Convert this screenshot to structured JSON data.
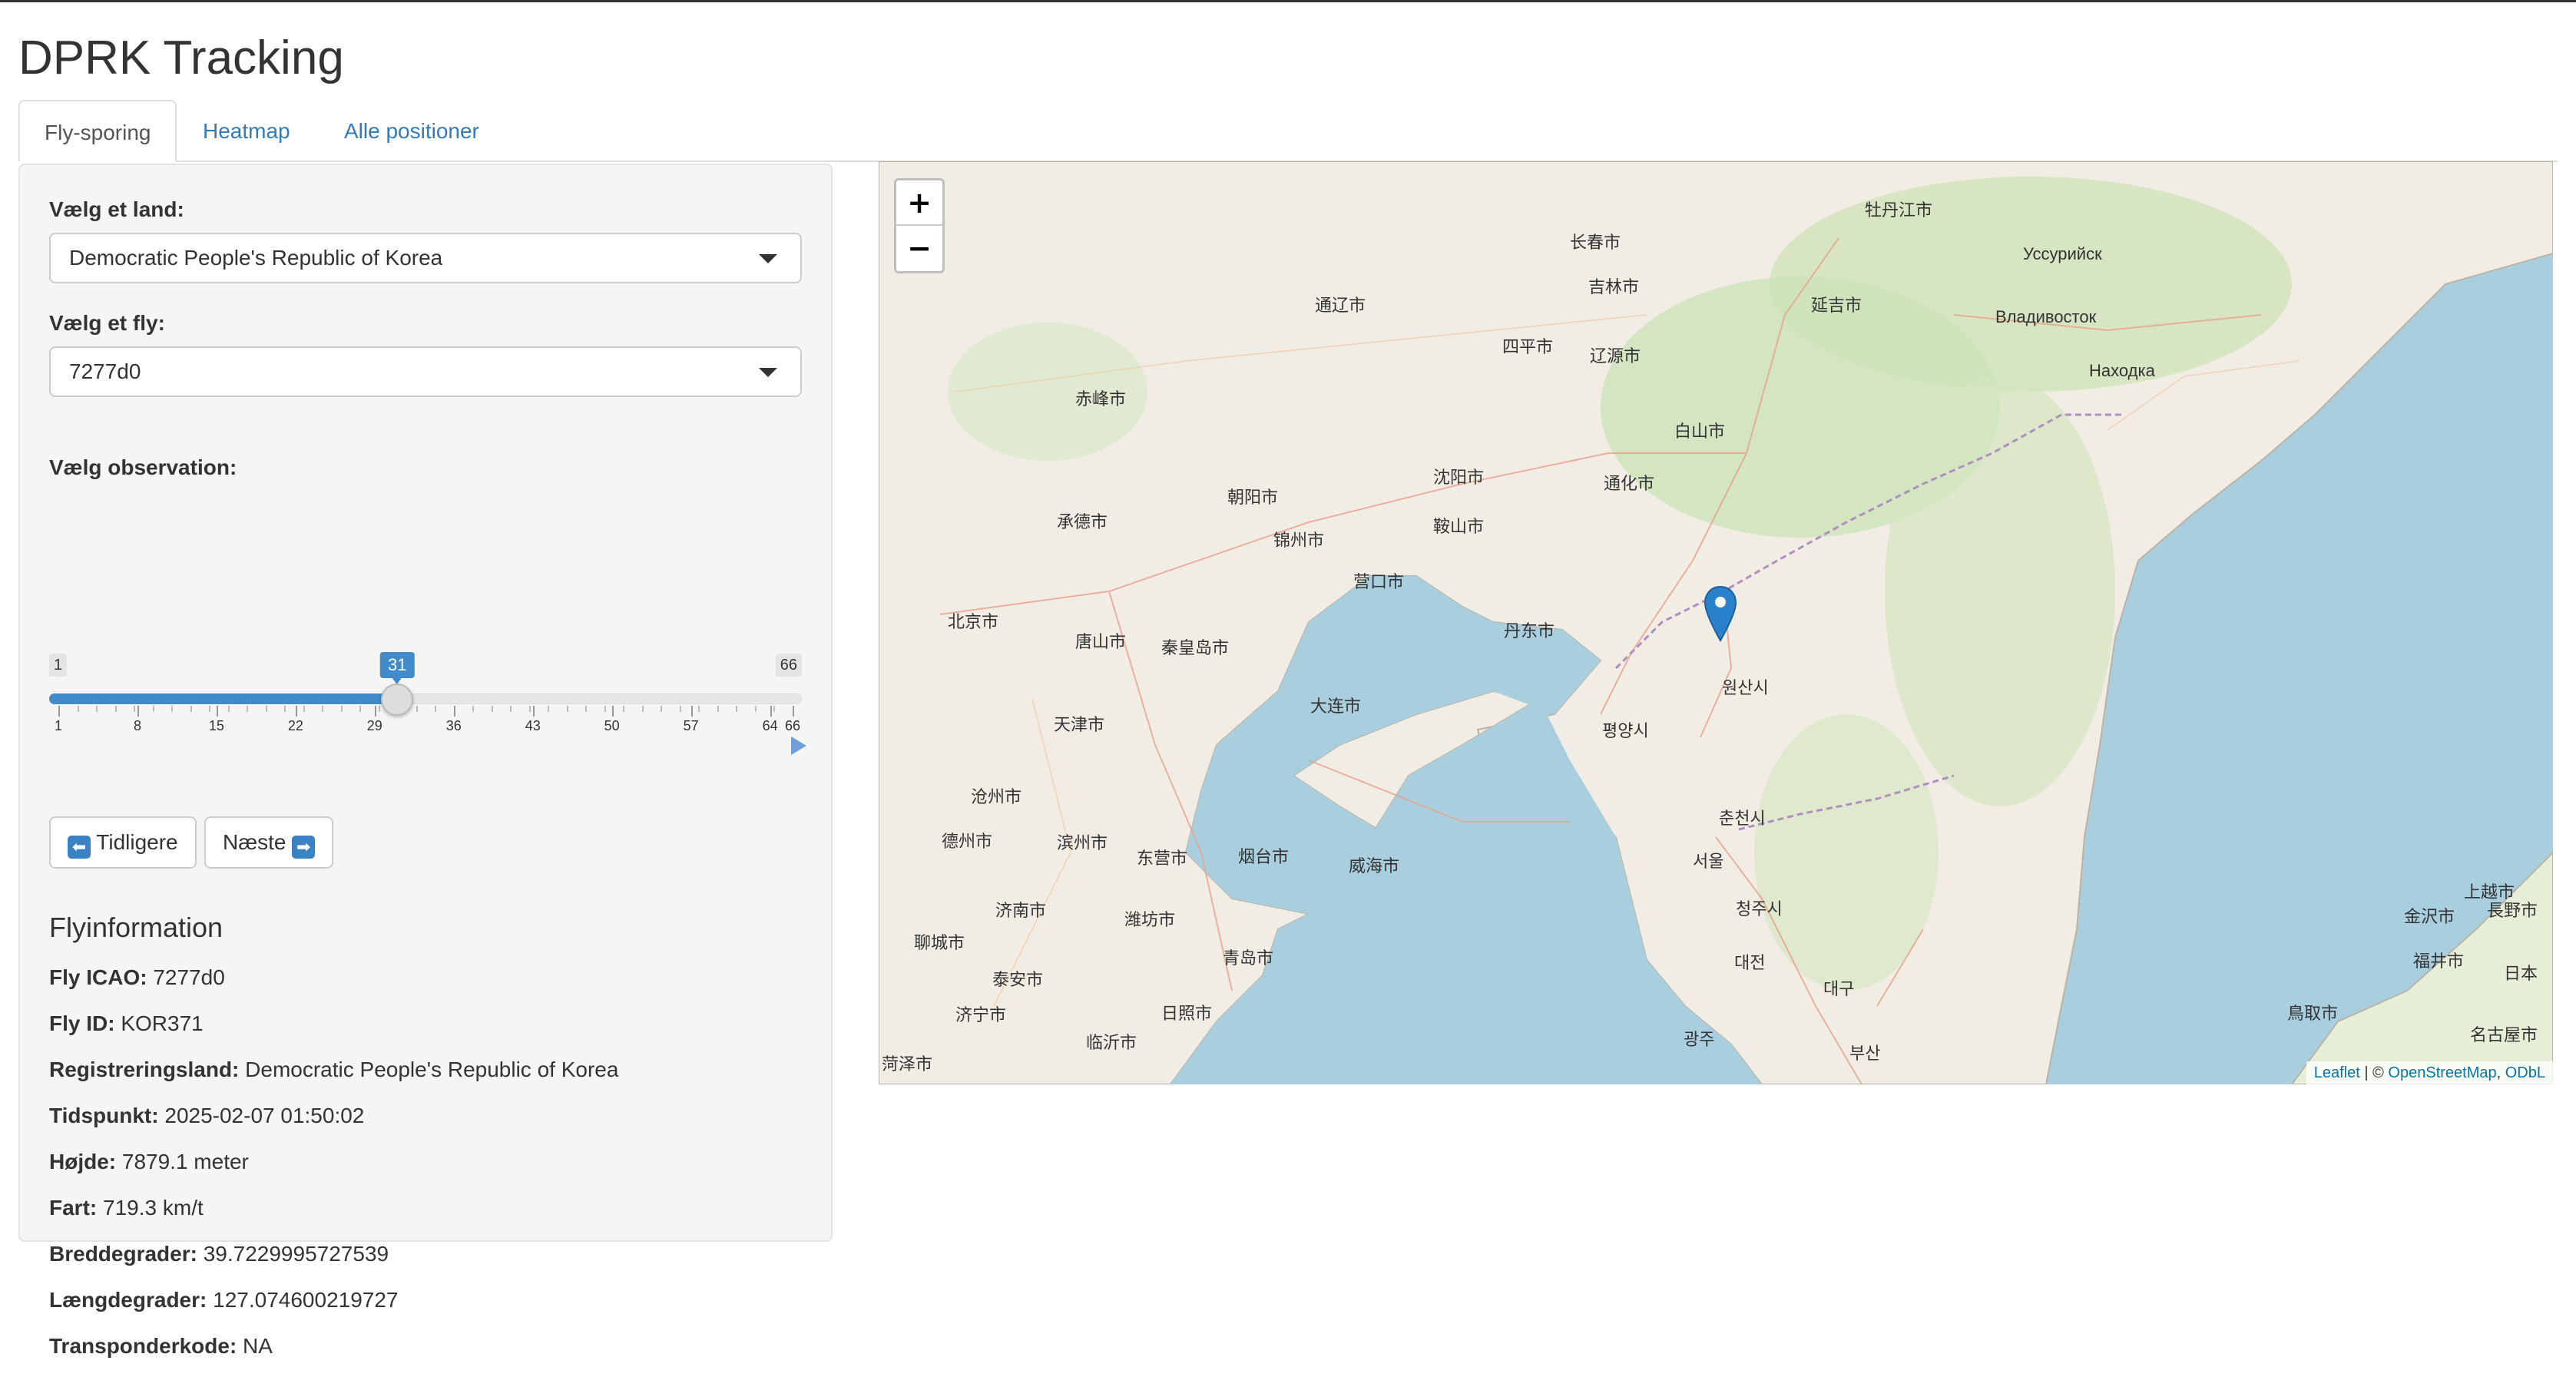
{
  "app": {
    "title": "DPRK Tracking"
  },
  "tabs": [
    {
      "label": "Fly-sporing",
      "active": true
    },
    {
      "label": "Heatmap",
      "active": false
    },
    {
      "label": "Alle positioner",
      "active": false
    }
  ],
  "sidebar": {
    "country": {
      "label": "Vælg et land:",
      "value": "Democratic People's Republic of Korea"
    },
    "aircraft": {
      "label": "Vælg et fly:",
      "value": "7277d0"
    },
    "observation": {
      "label": "Vælg observation:",
      "min": 1,
      "max": 66,
      "value": 31,
      "min_label": "1",
      "max_label": "66",
      "current_label": "31",
      "ticks": [
        "1",
        "8",
        "15",
        "22",
        "29",
        "36",
        "43",
        "50",
        "57",
        "64",
        "66"
      ]
    },
    "prev_button": {
      "label": "Tidligere",
      "icon": "⬅"
    },
    "next_button": {
      "label": "Næste",
      "icon": "➡"
    },
    "info": {
      "title": "Flyinformation",
      "fields": [
        {
          "label": "Fly ICAO:",
          "value": "7277d0"
        },
        {
          "label": "Fly ID:",
          "value": "KOR371"
        },
        {
          "label": "Registreringsland:",
          "value": "Democratic People's Republic of Korea"
        },
        {
          "label": "Tidspunkt:",
          "value": "2025-02-07 01:50:02"
        },
        {
          "label": "Højde:",
          "value": "7879.1 meter"
        },
        {
          "label": "Fart:",
          "value": "719.3 km/t"
        },
        {
          "label": "Breddegrader:",
          "value": "39.7229995727539"
        },
        {
          "label": "Længdegrader:",
          "value": "127.074600219727"
        },
        {
          "label": "Transponderkode:",
          "value": "NA"
        }
      ]
    }
  },
  "map": {
    "zoom_in": "+",
    "zoom_out": "−",
    "marker_icon": "map-pin-icon",
    "attribution": {
      "leaflet": "Leaflet",
      "separator": " | © ",
      "osm": "OpenStreetMap",
      "comma": ", ",
      "odbl": "ODbL"
    },
    "places": [
      {
        "name": "北京市"
      },
      {
        "name": "天津市"
      },
      {
        "name": "唐山市"
      },
      {
        "name": "秦皇岛市"
      },
      {
        "name": "沈阳市"
      },
      {
        "name": "大连市"
      },
      {
        "name": "丹东市"
      },
      {
        "name": "营口市"
      },
      {
        "name": "鞍山市"
      },
      {
        "name": "锦州市"
      },
      {
        "name": "朝阳市"
      },
      {
        "name": "承德市"
      },
      {
        "name": "赤峰市"
      },
      {
        "name": "通辽市"
      },
      {
        "name": "四平市"
      },
      {
        "name": "辽源市"
      },
      {
        "name": "长春市"
      },
      {
        "name": "吉林市"
      },
      {
        "name": "白山市"
      },
      {
        "name": "通化市"
      },
      {
        "name": "延吉市"
      },
      {
        "name": "牡丹江市"
      },
      {
        "name": "Владивосток"
      },
      {
        "name": "Находка"
      },
      {
        "name": "Уссурийск"
      },
      {
        "name": "평양시"
      },
      {
        "name": "원산시"
      },
      {
        "name": "서울"
      },
      {
        "name": "대전"
      },
      {
        "name": "대구"
      },
      {
        "name": "부산"
      },
      {
        "name": "광주"
      },
      {
        "name": "청주시"
      },
      {
        "name": "춘천시"
      },
      {
        "name": "烟台市"
      },
      {
        "name": "威海市"
      },
      {
        "name": "青岛市"
      },
      {
        "name": "日照市"
      },
      {
        "name": "临沂市"
      },
      {
        "name": "潍坊市"
      },
      {
        "name": "东营市"
      },
      {
        "name": "滨州市"
      },
      {
        "name": "德州市"
      },
      {
        "name": "济南市"
      },
      {
        "name": "泰安市"
      },
      {
        "name": "沧州市"
      },
      {
        "name": "聊城市"
      },
      {
        "name": "济宁市"
      },
      {
        "name": "菏泽市"
      },
      {
        "name": "金沢市"
      },
      {
        "name": "福井市"
      },
      {
        "name": "長野市"
      },
      {
        "name": "名古屋市"
      },
      {
        "name": "上越市"
      },
      {
        "name": "日本"
      },
      {
        "name": "鳥取市"
      }
    ]
  }
}
